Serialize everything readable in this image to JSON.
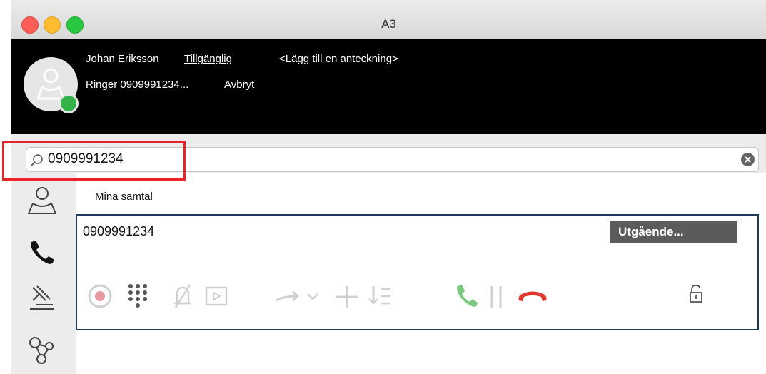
{
  "window": {
    "title": "A3"
  },
  "header": {
    "user_name": "Johan Eriksson",
    "presence": "Tillgänglig",
    "note_placeholder": "<Lägg till en anteckning>",
    "ringing_text": "Ringer 0909991234...",
    "cancel_label": "Avbryt",
    "presence_color": "#34b24a"
  },
  "search": {
    "value": "0909991234"
  },
  "sidebar": {
    "items": [
      "contacts-icon",
      "phone-icon",
      "sign-icon",
      "network-icon"
    ]
  },
  "main": {
    "section_title": "Mina samtal",
    "call": {
      "number": "0909991234",
      "status": "Utgående...",
      "controls": [
        "record-icon",
        "keypad-icon",
        "mute-icon",
        "video-icon",
        "transfer-icon",
        "transfer-dropdown-icon",
        "add-call-icon",
        "merge-icon",
        "answer-icon",
        "hold-icon",
        "hangup-icon",
        "lock-icon"
      ]
    }
  },
  "colors": {
    "hangup": "#e03a2e",
    "answer": "#7ac77f",
    "card_border": "#1e3a5a",
    "annotation": "#e8242b"
  }
}
